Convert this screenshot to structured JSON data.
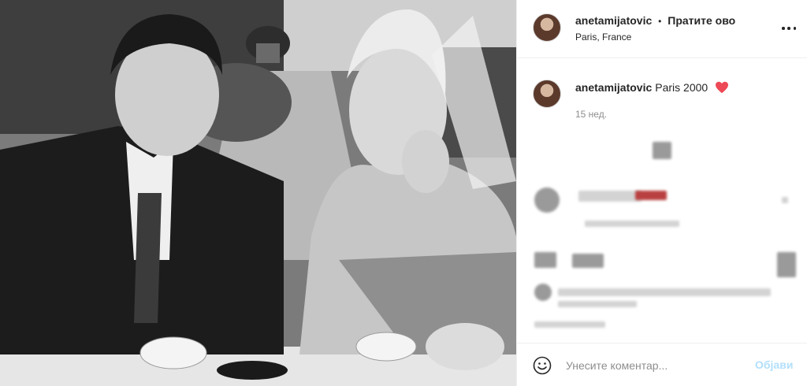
{
  "header": {
    "username": "anetamijatovic",
    "separator": "•",
    "follow_label": "Пратите ово",
    "location": "Paris, France"
  },
  "caption": {
    "username": "anetamijatovic",
    "text": "Paris 2000",
    "emoji": "heart-icon",
    "timestamp": "15 нед."
  },
  "comment_box": {
    "placeholder": "Унесите коментар...",
    "post_label": "Објави"
  },
  "photo": {
    "style": "black-and-white",
    "heart_color": "#ed4956"
  }
}
